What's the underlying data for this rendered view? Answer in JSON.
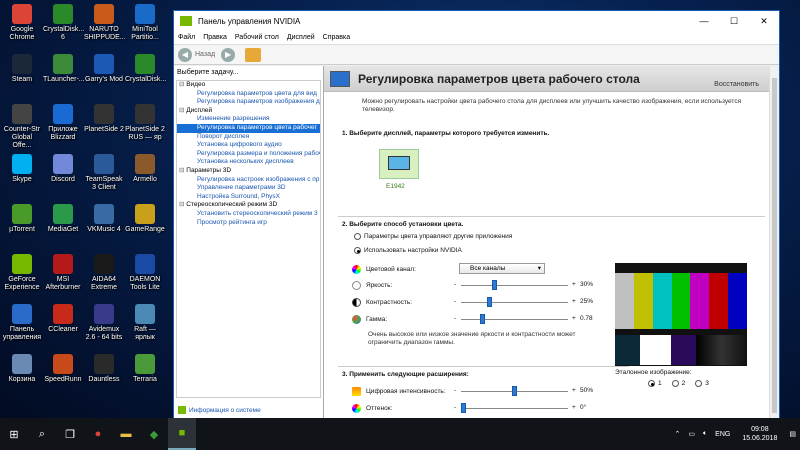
{
  "desktop_icons": [
    {
      "label": "Google Chrome",
      "icon": "chrome-icon",
      "color": "#db4437"
    },
    {
      "label": "CrystalDisk... 6",
      "icon": "crystaldisk-icon",
      "color": "#2a8a2a"
    },
    {
      "label": "NARUTO SHIPPUDE...",
      "icon": "naruto-icon",
      "color": "#c85a1a"
    },
    {
      "label": "MiniTool Partitio...",
      "icon": "minitool-icon",
      "color": "#1a6ac8"
    },
    {
      "label": "Steam",
      "icon": "steam-icon",
      "color": "#1b2838"
    },
    {
      "label": "TLauncher-...",
      "icon": "tlauncher-icon",
      "color": "#3a8a3a"
    },
    {
      "label": "Garry's Mod",
      "icon": "garrysmod-icon",
      "color": "#1a5ab4"
    },
    {
      "label": "CrystalDisk...",
      "icon": "crystaldisk-icon",
      "color": "#2a8a2a"
    },
    {
      "label": "Counter-Str Global Offe...",
      "icon": "csgo-icon",
      "color": "#444"
    },
    {
      "label": "Приложе Blizzard",
      "icon": "blizzard-icon",
      "color": "#1a6ad4"
    },
    {
      "label": "PlanetSide 2",
      "icon": "planetside-icon",
      "color": "#333"
    },
    {
      "label": "PlanetSide 2 RUS — яр",
      "icon": "planetside-icon",
      "color": "#333"
    },
    {
      "label": "Skype",
      "icon": "skype-icon",
      "color": "#00aff0"
    },
    {
      "label": "Discord",
      "icon": "discord-icon",
      "color": "#7289da"
    },
    {
      "label": "TeamSpeak 3 Client",
      "icon": "teamspeak-icon",
      "color": "#2a5a9a"
    },
    {
      "label": "Armello",
      "icon": "armello-icon",
      "color": "#8a5a2a"
    },
    {
      "label": "µTorrent",
      "icon": "utorrent-icon",
      "color": "#4a9a2a"
    },
    {
      "label": "MediaGet",
      "icon": "mediaget-icon",
      "color": "#2a9a4a"
    },
    {
      "label": "VKMusic 4",
      "icon": "vkmusic-icon",
      "color": "#3a6aa4"
    },
    {
      "label": "GameRange",
      "icon": "gamerange-icon",
      "color": "#c8a01a"
    },
    {
      "label": "GeForce Experience",
      "icon": "geforce-icon",
      "color": "#76b900"
    },
    {
      "label": "MSI Afterburner",
      "icon": "msi-icon",
      "color": "#b41a1a"
    },
    {
      "label": "AIDA64 Extreme",
      "icon": "aida64-icon",
      "color": "#1a1a1a"
    },
    {
      "label": "DAEMON Tools Lite",
      "icon": "daemon-icon",
      "color": "#1a4aa4"
    },
    {
      "label": "Панель управления",
      "icon": "control-panel-icon",
      "color": "#2a6ac8"
    },
    {
      "label": "CCleaner",
      "icon": "ccleaner-icon",
      "color": "#c82a1a"
    },
    {
      "label": "Avidemux 2.6 - 64 bits",
      "icon": "avidemux-icon",
      "color": "#3a3a8a"
    },
    {
      "label": "Raft — ярлык",
      "icon": "raft-icon",
      "color": "#4a8ab4"
    },
    {
      "label": "Корзина",
      "icon": "recycle-bin-icon",
      "color": "#6a8ab4"
    },
    {
      "label": "SpeedRunn",
      "icon": "speedrunners-icon",
      "color": "#c84a1a"
    },
    {
      "label": "Dauntless",
      "icon": "dauntless-icon",
      "color": "#2a2a2a"
    },
    {
      "label": "Terraria",
      "icon": "terraria-icon",
      "color": "#4a9a3a"
    }
  ],
  "window": {
    "title": "Панель управления NVIDIA",
    "menu": [
      "Файл",
      "Правка",
      "Рабочий стол",
      "Дисплей",
      "Справка"
    ],
    "toolbar": {
      "back_label": "Назад"
    },
    "task_header": "Выберите задачу...",
    "tree": [
      {
        "type": "cat",
        "label": "Видео"
      },
      {
        "type": "item",
        "label": "Регулировка параметров цвета для вид"
      },
      {
        "type": "item",
        "label": "Регулировка параметров изображения д"
      },
      {
        "type": "cat",
        "label": "Дисплей"
      },
      {
        "type": "item",
        "label": "Изменение разрешения"
      },
      {
        "type": "item",
        "label": "Регулировка параметров цвета рабочег",
        "selected": true
      },
      {
        "type": "item",
        "label": "Поворот дисплея"
      },
      {
        "type": "item",
        "label": "Установка цифрового аудио"
      },
      {
        "type": "item",
        "label": "Регулировка размера и положения рабоч"
      },
      {
        "type": "item",
        "label": "Установка нескольких дисплеев"
      },
      {
        "type": "cat",
        "label": "Параметры 3D"
      },
      {
        "type": "item",
        "label": "Регулировка настроек изображения с пр"
      },
      {
        "type": "item",
        "label": "Управление параметрами 3D"
      },
      {
        "type": "item",
        "label": "Настройка Surround, PhysX"
      },
      {
        "type": "cat",
        "label": "Стереоскопический режим 3D"
      },
      {
        "type": "item",
        "label": "Установить стереоскопический режим 3"
      },
      {
        "type": "item",
        "label": "Просмотр рейтинга игр"
      }
    ],
    "sysinfo": "Информация о системе",
    "page_title": "Регулировка параметров цвета рабочего стола",
    "restore": "Восстановить",
    "description": "Можно регулировать настройки цвета рабочего стола для дисплеев или улучшить качество изображения, если используется телевизор.",
    "step1": "1. Выберите дисплей, параметры которого требуется изменить.",
    "monitor_label": "E1942",
    "step2": "2. Выберите способ установки цвета.",
    "radio_other_apps": "Параметры цвета управляют другие приложения",
    "radio_nvidia": "Использовать настройки NVIDIA",
    "channel_label": "Цветовой канал:",
    "channel_value": "Все каналы",
    "brightness": {
      "label": "Яркость:",
      "value": "30%",
      "level": 0.3
    },
    "contrast": {
      "label": "Контрастность:",
      "value": "25%",
      "level": 0.25
    },
    "gamma": {
      "label": "Гамма:",
      "value": "0.78",
      "level": 0.19
    },
    "note": "Очень высокое или низкое значение яркости и контрастности может ограничить диапазон гаммы.",
    "step3": "3. Применить следующие расширения:",
    "digital_vibrance": {
      "label": "Цифровая интенсивность:",
      "value": "50%",
      "level": 0.5
    },
    "hue": {
      "label": "Оттенок:",
      "value": "0°",
      "level": 0.0
    },
    "minus": "-",
    "plus": "+",
    "reference_label": "Эталонное изображение:",
    "reference_options": [
      "1",
      "2",
      "3"
    ]
  },
  "taskbar": {
    "lang": "ENG",
    "time": "09:08",
    "date": "15.06.2018"
  }
}
